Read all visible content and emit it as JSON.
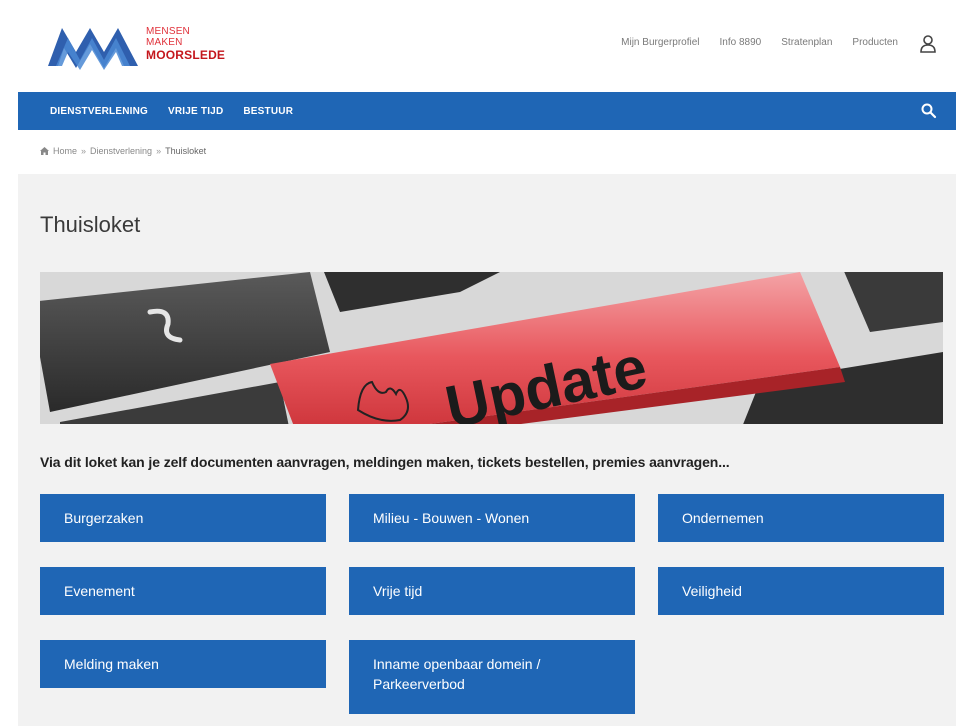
{
  "brand": {
    "line1": "MENSEN",
    "line2": "MAKEN",
    "line3": "MOORSLEDE"
  },
  "top_links": [
    "Mijn Burgerprofiel",
    "Info 8890",
    "Stratenplan",
    "Producten"
  ],
  "nav": {
    "items": [
      "DIENSTVERLENING",
      "VRIJE TIJD",
      "BESTUUR"
    ]
  },
  "breadcrumb": {
    "items": [
      "Home",
      "Dienstverlening",
      "Thuisloket"
    ]
  },
  "page": {
    "title": "Thuisloket",
    "hero_text": "Update",
    "intro": "Via dit loket kan je zelf documenten aanvragen, meldingen maken, tickets bestellen, premies aanvragen..."
  },
  "tiles": [
    "Burgerzaken",
    "Milieu - Bouwen - Wonen",
    "Ondernemen",
    "Evenement",
    "Vrije tijd",
    "Veiligheid",
    "Melding maken",
    "Inname openbaar domein / Parkeerverbod"
  ],
  "colors": {
    "primary": "#1f66b5",
    "brand_red": "#c4161c",
    "content_bg": "#f2f2f2"
  },
  "icons": {
    "user": "user-icon",
    "search": "search-icon",
    "home": "home-icon"
  }
}
